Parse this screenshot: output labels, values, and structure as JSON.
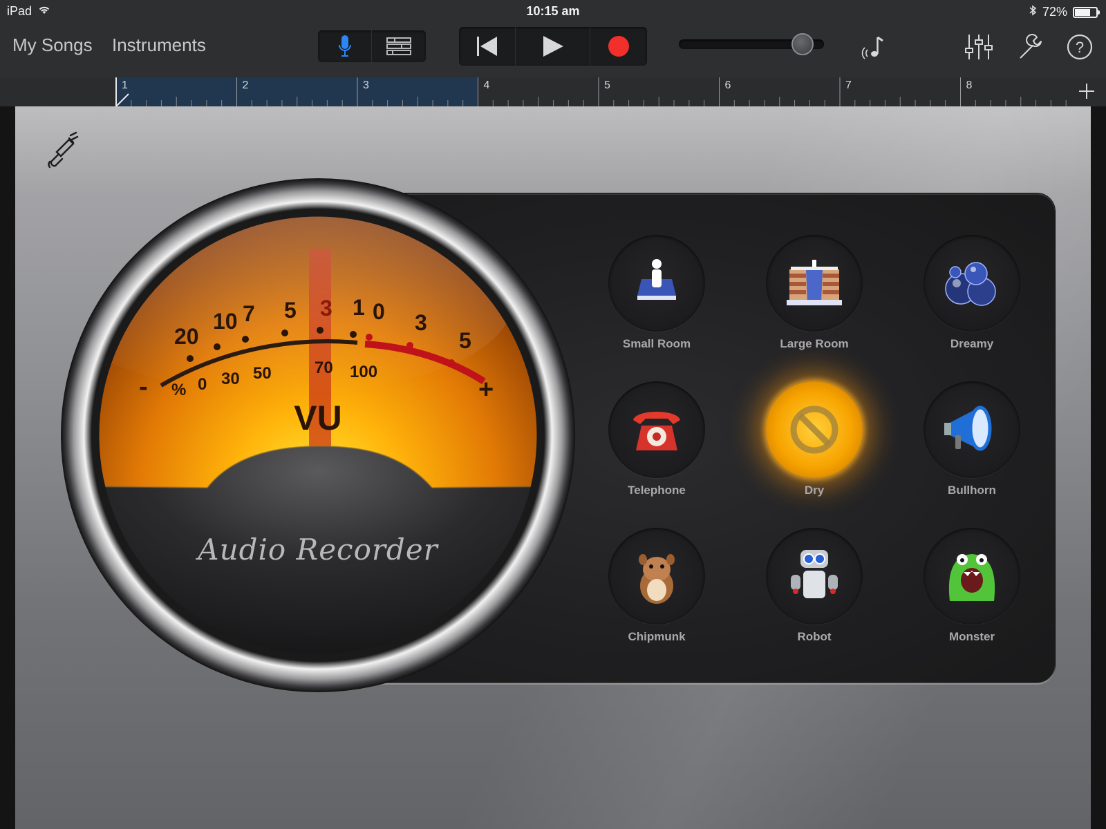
{
  "status_bar": {
    "device": "iPad",
    "time": "10:15 am",
    "battery": "72%",
    "battery_level": 0.72,
    "icons": [
      "wifi-icon",
      "bluetooth-icon",
      "battery-icon"
    ]
  },
  "toolbar": {
    "my_songs": "My Songs",
    "instruments": "Instruments",
    "view_buttons": [
      "microphone-icon",
      "tracks-view-icon"
    ],
    "transport": [
      "go-to-beginning-icon",
      "play-icon",
      "record-icon"
    ],
    "volume_level": 0.95,
    "right_icons": [
      "metronome-icon",
      "mixer-icon",
      "settings-wrench-icon",
      "help-icon"
    ],
    "colors": {
      "accent_blue": "#2b86f6",
      "record_red": "#f2302b"
    }
  },
  "ruler": {
    "bars": [
      "1",
      "2",
      "3",
      "4",
      "5",
      "6",
      "7",
      "8"
    ],
    "region_bars": 3
  },
  "vu_meter": {
    "title": "VU",
    "brand": "Audio Recorder",
    "minus": "-",
    "plus": "+",
    "percent": "%",
    "db_scale": [
      "20",
      "10",
      "7",
      "5",
      "3",
      "1",
      "0",
      "3",
      "5"
    ],
    "percent_scale": [
      "0",
      "30",
      "50",
      "70",
      "100"
    ]
  },
  "effects": [
    {
      "label": "Small Room",
      "icon": "small-room-icon",
      "selected": false
    },
    {
      "label": "Large Room",
      "icon": "large-room-icon",
      "selected": false
    },
    {
      "label": "Dreamy",
      "icon": "dreamy-bubbles-icon",
      "selected": false
    },
    {
      "label": "Telephone",
      "icon": "telephone-icon",
      "selected": false
    },
    {
      "label": "Dry",
      "icon": "dry-no-effect-icon",
      "selected": true
    },
    {
      "label": "Bullhorn",
      "icon": "bullhorn-icon",
      "selected": false
    },
    {
      "label": "Chipmunk",
      "icon": "chipmunk-icon",
      "selected": false
    },
    {
      "label": "Robot",
      "icon": "robot-icon",
      "selected": false
    },
    {
      "label": "Monster",
      "icon": "monster-icon",
      "selected": false
    }
  ]
}
